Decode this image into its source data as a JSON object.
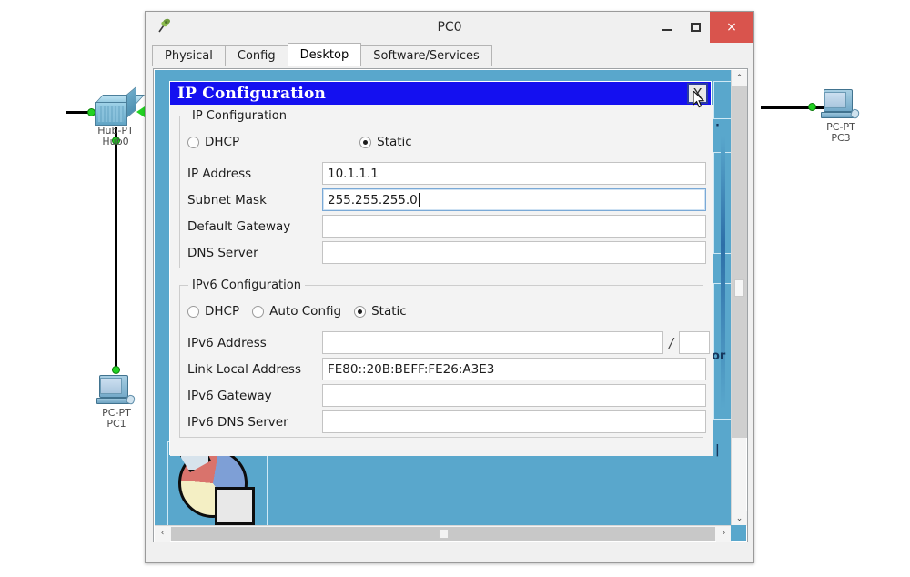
{
  "window": {
    "title": "PC0",
    "icon": "packet-tracer-icon",
    "buttons": {
      "minimize": "–",
      "maximize": "❐",
      "close": "×"
    },
    "tabs": [
      {
        "label": "Physical",
        "active": false
      },
      {
        "label": "Config",
        "active": false
      },
      {
        "label": "Desktop",
        "active": true
      },
      {
        "label": "Software/Services",
        "active": false
      }
    ]
  },
  "topology": {
    "devices": [
      {
        "type": "hub",
        "model": "Hub-PT",
        "name": "Hub0"
      },
      {
        "type": "pc",
        "model": "PC-PT",
        "name": "PC1"
      },
      {
        "type": "pc",
        "model": "PC-PT",
        "name": "PC3"
      }
    ]
  },
  "desktop": {
    "background_color": "#59a7cc",
    "icon": "pie-chart-document-icon",
    "background_app_text": "or"
  },
  "dialog": {
    "title": "IP Configuration",
    "close_label": "X",
    "ipv4": {
      "legend": "IP Configuration",
      "mode_options": [
        {
          "label": "DHCP",
          "selected": false
        },
        {
          "label": "Static",
          "selected": true
        }
      ],
      "fields": [
        {
          "label": "IP Address",
          "value": "10.1.1.1",
          "focused": false
        },
        {
          "label": "Subnet Mask",
          "value": "255.255.255.0",
          "focused": true
        },
        {
          "label": "Default Gateway",
          "value": "",
          "focused": false
        },
        {
          "label": "DNS Server",
          "value": "",
          "focused": false
        }
      ]
    },
    "ipv6": {
      "legend": "IPv6 Configuration",
      "mode_options": [
        {
          "label": "DHCP",
          "selected": false
        },
        {
          "label": "Auto Config",
          "selected": false
        },
        {
          "label": "Static",
          "selected": true
        }
      ],
      "address_label": "IPv6 Address",
      "address_value": "",
      "prefix_separator": "/",
      "prefix_value": "",
      "fields": [
        {
          "label": "Link Local Address",
          "value": "FE80::20B:BEFF:FE26:A3E3"
        },
        {
          "label": "IPv6 Gateway",
          "value": ""
        },
        {
          "label": "IPv6 DNS Server",
          "value": ""
        }
      ]
    }
  },
  "scrollbars": {
    "vertical": {
      "up": "⌃",
      "down": "⌄"
    },
    "horizontal": {
      "left": "‹",
      "right": "›"
    }
  },
  "colors": {
    "dialog_title_bg": "#1410f0",
    "desktop_bg": "#59a7cc",
    "close_button_bg": "#d9544d",
    "link_dot": "#22d122"
  }
}
